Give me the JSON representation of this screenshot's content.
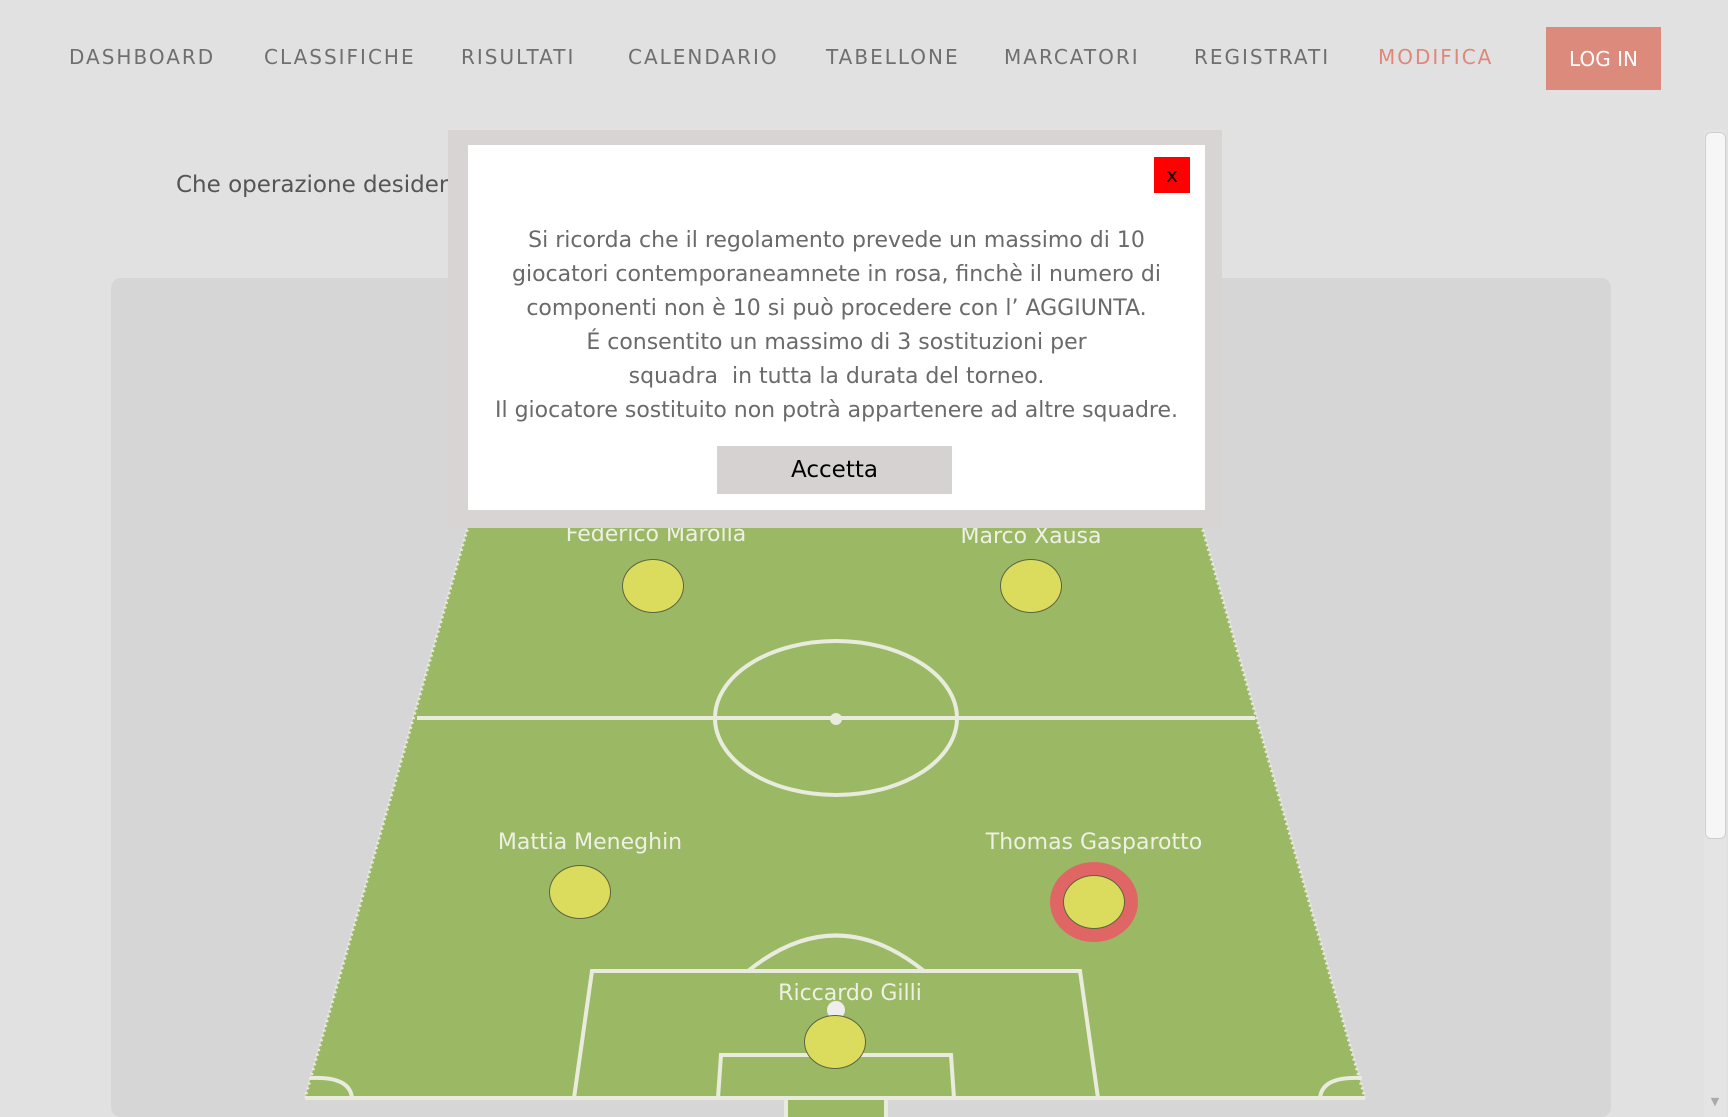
{
  "nav": {
    "items": [
      {
        "label": "DASHBOARD"
      },
      {
        "label": "CLASSIFICHE"
      },
      {
        "label": "RISULTATI"
      },
      {
        "label": "CALENDARIO"
      },
      {
        "label": "TABELLONE"
      },
      {
        "label": "MARCATORI"
      },
      {
        "label": "REGISTRATI"
      },
      {
        "label": "MODIFICA"
      }
    ],
    "active": "MODIFICA",
    "login_label": "LOG IN",
    "active_color": "#e0877a",
    "login_color": "#dc8a7c"
  },
  "main": {
    "prompt_partial": "Che operazione desideri"
  },
  "pitch": {
    "grass_color": "#9bb865",
    "player_color": "#dbdc5e",
    "selected_ring_color": "#e06666",
    "players": [
      {
        "name": "Federico Marolla",
        "selected": false
      },
      {
        "name": "Marco Xausa",
        "selected": false
      },
      {
        "name": "Mattia Meneghin",
        "selected": false
      },
      {
        "name": "Thomas Gasparotto",
        "selected": true
      },
      {
        "name": "Riccardo Gilli",
        "selected": false
      }
    ]
  },
  "modal": {
    "close_label": "x",
    "lines": [
      "Si ricorda che il regolamento prevede un massimo di 10",
      "giocatori contemporaneamnete in rosa, finchè il numero di",
      "componenti non è 10 si può procedere con l’ AGGIUNTA.",
      "É consentito un massimo di 3 sostituzioni per",
      "squadra  in tutta la durata del torneo.",
      "Il giocatore sostituito non potrà appartenere ad altre squadre."
    ],
    "accept_label": "Accetta",
    "close_color": "#ff0000"
  }
}
